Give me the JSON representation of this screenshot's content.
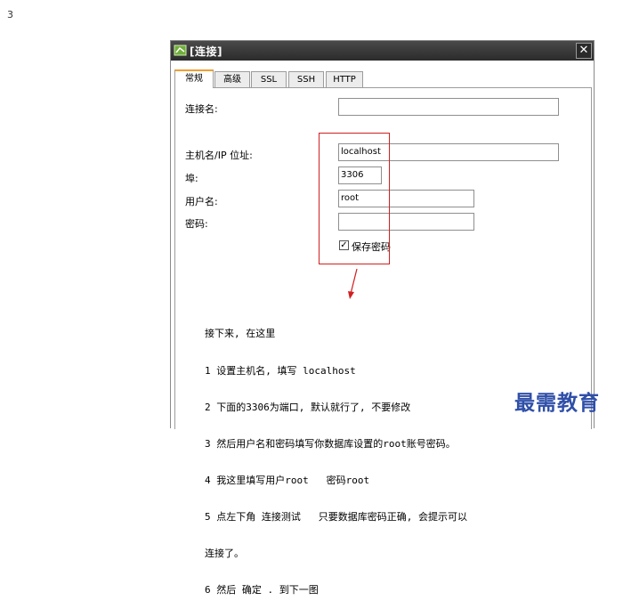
{
  "step_number": "3",
  "dialog": {
    "title": "[连接]",
    "tabs": [
      {
        "label": "常规",
        "active": true
      },
      {
        "label": "高级",
        "active": false
      },
      {
        "label": "SSL",
        "active": false
      },
      {
        "label": "SSH",
        "active": false
      },
      {
        "label": "HTTP",
        "active": false
      }
    ],
    "fields": {
      "connection_name": {
        "label": "连接名:",
        "value": ""
      },
      "host": {
        "label": "主机名/IP 位址:",
        "value": "localhost"
      },
      "port": {
        "label": "埠:",
        "value": "3306"
      },
      "username": {
        "label": "用户名:",
        "value": "root"
      },
      "password": {
        "label": "密码:",
        "value": ""
      }
    },
    "save_password": {
      "label": "保存密码",
      "checked": true
    }
  },
  "annotation": {
    "box_color": "#d21f1f",
    "lines": [
      "接下来, 在这里",
      "1 设置主机名, 填写 localhost",
      "2 下面的3306为端口, 默认就行了, 不要修改",
      "3 然后用户名和密码填写你数据库设置的root账号密码。",
      "4 我这里填写用户root   密码root",
      "5 点左下角 连接测试   只要数据库密码正确, 会提示可以",
      "连接了。",
      "6 然后 确定 . 到下一图"
    ]
  },
  "watermark": "最需教育"
}
